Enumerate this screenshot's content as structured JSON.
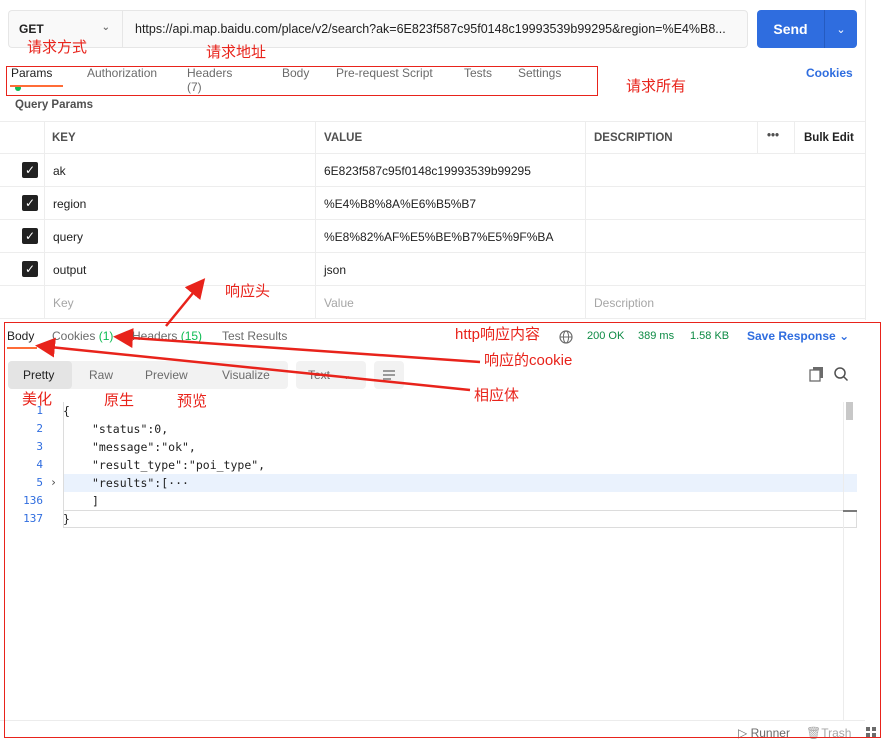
{
  "request": {
    "method": "GET",
    "url": "https://api.map.baidu.com/place/v2/search?ak=6E823f587c95f0148c19993539b99295&region=%E4%B8..."
  },
  "send_label": "Send",
  "request_tabs": {
    "params": "Params",
    "authorization": "Authorization",
    "headers": "Headers (7)",
    "body": "Body",
    "prerequest": "Pre-request Script",
    "tests": "Tests",
    "settings": "Settings",
    "cookies": "Cookies"
  },
  "query_params_title": "Query Params",
  "params_table": {
    "headers": {
      "key": "KEY",
      "value": "VALUE",
      "description": "DESCRIPTION",
      "more": "•••",
      "bulk_edit": "Bulk Edit"
    },
    "rows": [
      {
        "key": "ak",
        "value": "6E823f587c95f0148c19993539b99295",
        "checked": true
      },
      {
        "key": "region",
        "value": "%E4%B8%8A%E6%B5%B7",
        "checked": true
      },
      {
        "key": "query",
        "value": "%E8%82%AF%E5%BE%B7%E5%9F%BA",
        "checked": true
      },
      {
        "key": "output",
        "value": "json",
        "checked": true
      }
    ],
    "placeholders": {
      "key": "Key",
      "value": "Value",
      "description": "Description"
    }
  },
  "response_tabs": {
    "body": "Body",
    "cookies": "Cookies",
    "cookies_count": "(1)",
    "headers": "Headers",
    "headers_count": "(15)",
    "test_results": "Test Results"
  },
  "response_status": {
    "status": "200 OK",
    "time": "389 ms",
    "size": "1.58 KB",
    "save_response": "Save Response"
  },
  "view_modes": {
    "pretty": "Pretty",
    "raw": "Raw",
    "preview": "Preview",
    "visualize": "Visualize",
    "format": "Text"
  },
  "code_lines": [
    {
      "num": "1",
      "text": "{"
    },
    {
      "num": "2",
      "text": "\"status\":0,"
    },
    {
      "num": "3",
      "text": "\"message\":\"ok\","
    },
    {
      "num": "4",
      "text": "\"result_type\":\"poi_type\","
    },
    {
      "num": "5",
      "text": "\"results\":[···"
    },
    {
      "num": "136",
      "text": "]"
    },
    {
      "num": "137",
      "text": "}"
    }
  ],
  "footer": {
    "runner": "Runner",
    "trash": "Trash"
  },
  "annotations": {
    "method": "请求方式",
    "url": "请求地址",
    "all": "请求所有",
    "resp_header": "响应头",
    "http_resp": "http响应内容",
    "resp_cookie": "响应的cookie",
    "resp_body": "相应体",
    "pretty": "美化",
    "raw": "原生",
    "preview": "预览"
  },
  "colors": {
    "accent": "#ff6c37",
    "send": "#2f6ddf",
    "success": "#0cbb52",
    "annotation": "#e8231b"
  }
}
